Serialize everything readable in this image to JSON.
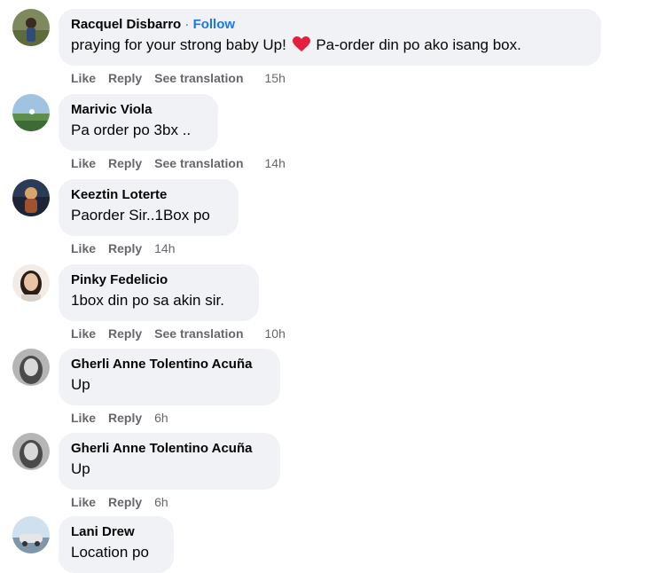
{
  "comments": [
    {
      "author": "Racquel Disbarro",
      "follow_sep": "·",
      "follow": "Follow",
      "text_before": "praying for your strong baby Up!",
      "text_after": "Pa-order din po ako isang box.",
      "actions": {
        "like": "Like",
        "reply": "Reply",
        "translate": "See translation"
      },
      "time": "15h"
    },
    {
      "author": "Marivic Viola",
      "text": "Pa order po 3bx ..",
      "actions": {
        "like": "Like",
        "reply": "Reply",
        "translate": "See translation"
      },
      "time": "14h"
    },
    {
      "author": "Keeztin Loterte",
      "text": "Paorder Sir..1Box po",
      "actions": {
        "like": "Like",
        "reply": "Reply"
      },
      "time": "14h"
    },
    {
      "author": "Pinky Fedelicio",
      "text": "1box din po sa akin sir.",
      "actions": {
        "like": "Like",
        "reply": "Reply",
        "translate": "See translation"
      },
      "time": "10h"
    },
    {
      "author": "Gherli Anne Tolentino Acuña",
      "text": "Up",
      "actions": {
        "like": "Like",
        "reply": "Reply"
      },
      "time": "6h"
    },
    {
      "author": "Gherli Anne Tolentino Acuña",
      "text": "Up",
      "actions": {
        "like": "Like",
        "reply": "Reply"
      },
      "time": "6h"
    },
    {
      "author": "Lani Drew",
      "text": "Location po"
    }
  ],
  "colors": {
    "bubble": "#f0f2f5",
    "link": "#1877f2",
    "muted": "#65676b",
    "heart": "#e41e3f"
  },
  "icons": [
    "heart-emoji-icon"
  ]
}
